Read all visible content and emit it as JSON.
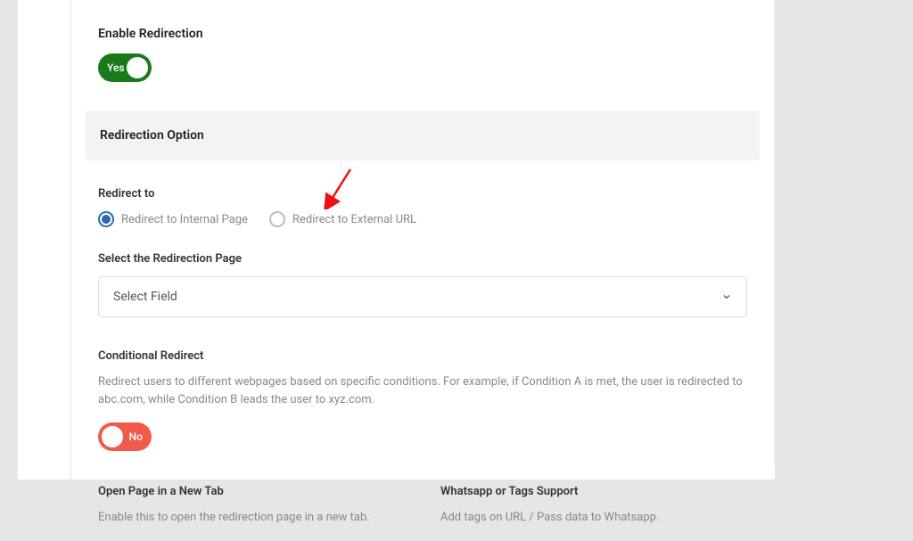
{
  "enableRedirection": {
    "label": "Enable Redirection",
    "toggle": {
      "state": "on",
      "text": "Yes"
    }
  },
  "redirectionOption": {
    "header": "Redirection Option",
    "redirectTo": {
      "label": "Redirect to",
      "options": {
        "internal": "Redirect to Internal Page",
        "external": "Redirect to External URL"
      }
    },
    "selectPage": {
      "label": "Select the Redirection Page",
      "placeholder": "Select Field"
    },
    "conditional": {
      "label": "Conditional Redirect",
      "description": "Redirect users to different webpages based on specific conditions. For example, if Condition A is met, the user is redirected to abc.com, while Condition B leads the user to xyz.com.",
      "toggle": {
        "state": "off",
        "text": "No"
      }
    },
    "newTab": {
      "label": "Open Page in a New Tab",
      "description": "Enable this to open the redirection page in a new tab."
    },
    "whatsapp": {
      "label": "Whatsapp or Tags Support",
      "description": "Add tags on URL / Pass data to Whatsapp."
    }
  }
}
